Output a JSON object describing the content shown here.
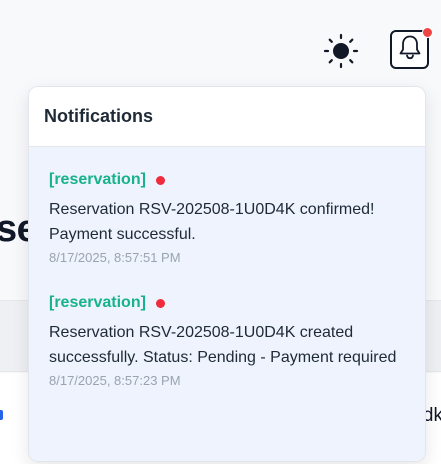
{
  "background": {
    "heading_fragment": "se",
    "right_text_fragment": "dk"
  },
  "header": {
    "theme_toggle_icon": "sun-icon",
    "notifications_icon": "bell-icon",
    "has_unread": true
  },
  "notifications": {
    "title": "Notifications",
    "items": [
      {
        "type": "[reservation]",
        "unread": true,
        "message": "Reservation RSV-202508-1U0D4K confirmed! Payment successful.",
        "timestamp": "8/17/2025, 8:57:51 PM"
      },
      {
        "type": "[reservation]",
        "unread": true,
        "message": "Reservation RSV-202508-1U0D4K created successfully. Status: Pending - Payment required",
        "timestamp": "8/17/2025, 8:57:23 PM"
      }
    ]
  },
  "colors": {
    "type_label": "#18b38a",
    "unread_dot": "#ef2b3c",
    "list_background": "#eef3fd"
  }
}
